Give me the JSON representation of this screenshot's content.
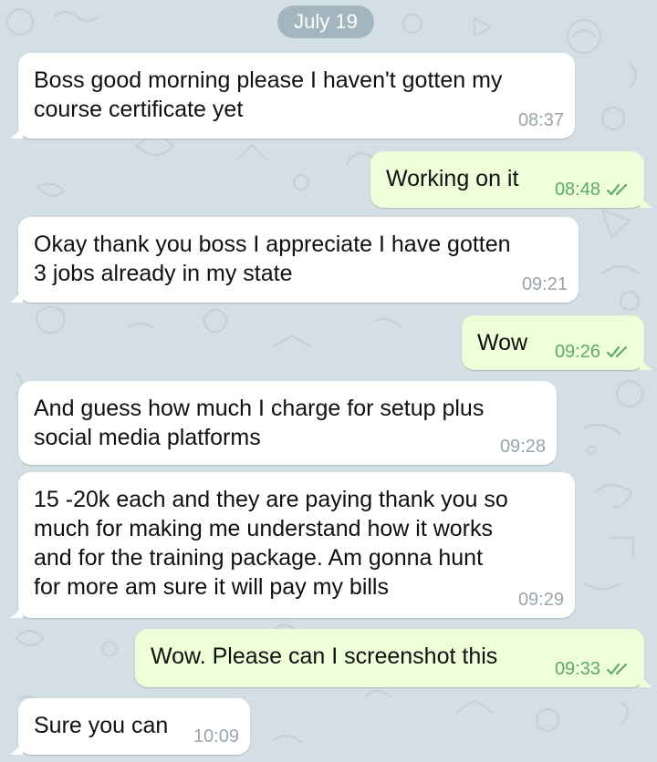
{
  "chat": {
    "date_label": "July 19",
    "colors": {
      "background": "#d3dfe4",
      "incoming_bubble": "#ffffff",
      "outgoing_bubble": "#eefed8",
      "outgoing_time": "#62a86a",
      "incoming_time": "#9aa4ab",
      "date_pill": "#a3b6bf"
    },
    "messages": [
      {
        "direction": "incoming",
        "lines": [
          "Boss good morning please I haven't gotten my",
          "course certificate yet"
        ],
        "time": "08:37"
      },
      {
        "direction": "outgoing",
        "lines": [
          "Working on it"
        ],
        "time": "08:48",
        "status_icon": "double-check-icon"
      },
      {
        "direction": "incoming",
        "lines": [
          "Okay thank you boss I appreciate I have gotten",
          "3 jobs already in my state"
        ],
        "time": "09:21"
      },
      {
        "direction": "outgoing",
        "lines": [
          "Wow"
        ],
        "time": "09:26",
        "status_icon": "double-check-icon"
      },
      {
        "direction": "incoming",
        "lines": [
          "And guess how much I charge for setup plus",
          "social media platforms"
        ],
        "time": "09:28"
      },
      {
        "direction": "incoming",
        "lines": [
          "15 -20k each and they are paying thank you so",
          "much for making me understand how it works",
          "and for the training package. Am gonna hunt",
          "for more am sure it will pay my bills"
        ],
        "time": "09:29"
      },
      {
        "direction": "outgoing",
        "lines": [
          "Wow. Please can I screenshot this"
        ],
        "time": "09:33",
        "status_icon": "double-check-icon"
      },
      {
        "direction": "incoming",
        "lines": [
          "Sure you can"
        ],
        "time": "10:09"
      }
    ]
  }
}
